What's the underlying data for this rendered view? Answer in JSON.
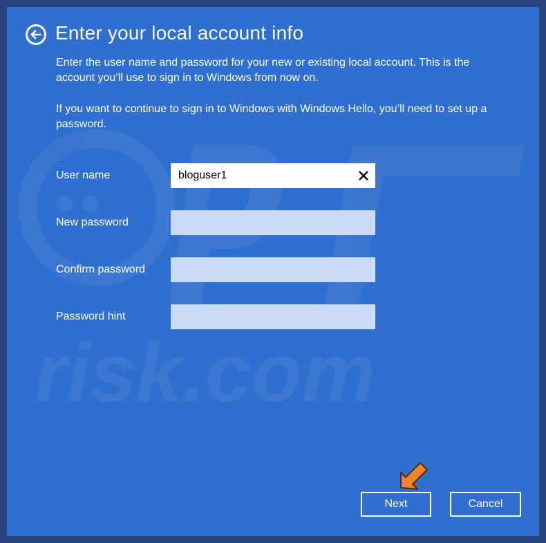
{
  "dialog": {
    "title": "Enter your local account info",
    "description_1": "Enter the user name and password for your new or existing local account. This is the account you’ll use to sign in to Windows from now on.",
    "description_2": "If you want to continue to sign in to Windows with Windows Hello, you’ll need to set up a password."
  },
  "form": {
    "username_label": "User name",
    "username_value": "bloguser1",
    "new_password_label": "New password",
    "new_password_value": "",
    "confirm_password_label": "Confirm password",
    "confirm_password_value": "",
    "password_hint_label": "Password hint",
    "password_hint_value": ""
  },
  "buttons": {
    "next_label": "Next",
    "cancel_label": "Cancel"
  },
  "watermark": {
    "text": "risk.com"
  },
  "icons": {
    "back": "back-arrow-icon",
    "clear": "close-icon",
    "pointer": "pointer-arrow-icon"
  },
  "colors": {
    "background": "#2f6fcf",
    "frame": "#27467f",
    "text": "#ffffff",
    "pointer_arrow": "#f0862c"
  }
}
